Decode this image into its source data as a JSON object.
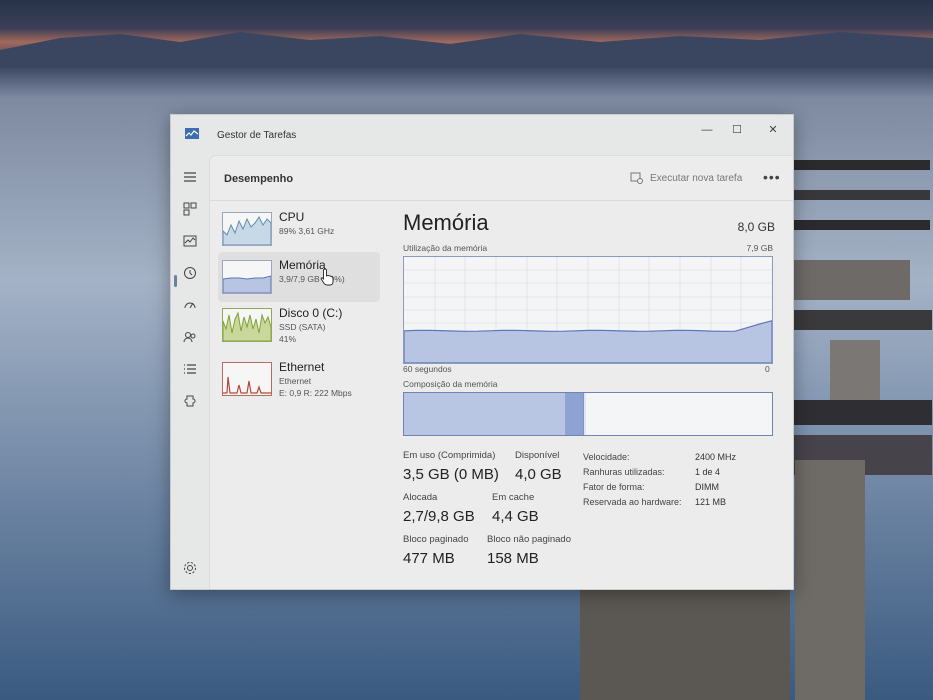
{
  "window": {
    "title": "Gestor de Tarefas",
    "controls": {
      "minimize": "—",
      "maximize": "☐",
      "close": "✕"
    }
  },
  "rail": {
    "icons": [
      "hamburger-icon",
      "processes-icon",
      "performance-icon",
      "history-icon",
      "startup-icon",
      "users-icon",
      "details-icon",
      "services-icon"
    ],
    "settings_icon": "gear-icon"
  },
  "header": {
    "page_title": "Desempenho",
    "run_task": "Executar nova tarefa",
    "more": "•••"
  },
  "perf_items": [
    {
      "name": "CPU",
      "sub1": "89% 3,61 GHz",
      "sub2": "",
      "sub3": "",
      "selected": false,
      "color": "#5d8fb3"
    },
    {
      "name": "Memória",
      "sub1": "3,9/7,9 GB (49%)",
      "sub2": "",
      "sub3": "",
      "selected": true,
      "color": "#6f84b2"
    },
    {
      "name": "Disco 0 (C:)",
      "sub1": "SSD (SATA)",
      "sub2": "41%",
      "sub3": "",
      "selected": false,
      "color": "#7ea236"
    },
    {
      "name": "Ethernet",
      "sub1": "Ethernet",
      "sub2": "E: 0,9 R: 222 Mbps",
      "sub3": "",
      "selected": false,
      "color": "#b04a3b"
    }
  ],
  "detail": {
    "title": "Memória",
    "total": "8,0 GB",
    "usage_label": "Utilização da memória",
    "usage_max": "7,9 GB",
    "time_left": "60 segundos",
    "time_right": "0",
    "composition_label": "Composição da memória",
    "usage_fraction": 0.49,
    "stats": {
      "in_use_label": "Em uso (Comprimida)",
      "in_use_value": "3,5 GB (0 MB)",
      "available_label": "Disponível",
      "available_value": "4,0 GB",
      "committed_label": "Alocada",
      "committed_value": "2,7/9,8 GB",
      "cached_label": "Em cache",
      "cached_value": "4,4 GB",
      "paged_label": "Bloco paginado",
      "paged_value": "477 MB",
      "nonpaged_label": "Bloco não paginado",
      "nonpaged_value": "158 MB"
    },
    "specs": [
      {
        "label": "Velocidade:",
        "value": "2400 MHz"
      },
      {
        "label": "Ranhuras utilizadas:",
        "value": "1 de 4"
      },
      {
        "label": "Fator de forma:",
        "value": "DIMM"
      },
      {
        "label": "Reservada ao hardware:",
        "value": "121 MB"
      }
    ]
  },
  "colors": {
    "memory_line": "#5c78b5",
    "memory_fill": "#b7c5e2",
    "composition_inuse": "#b8c6e3",
    "composition_modified": "#8ea3d3"
  }
}
